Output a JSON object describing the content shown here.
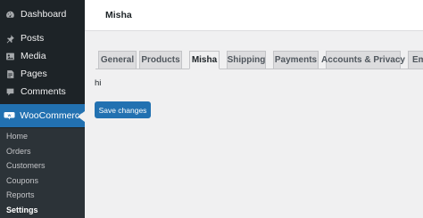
{
  "sidebar": {
    "items": [
      {
        "label": "Dashboard",
        "icon": "dashboard-icon"
      },
      {
        "label": "Posts",
        "icon": "pin-icon"
      },
      {
        "label": "Media",
        "icon": "media-icon"
      },
      {
        "label": "Pages",
        "icon": "page-icon"
      },
      {
        "label": "Comments",
        "icon": "comment-icon"
      },
      {
        "label": "WooCommerce",
        "icon": "woocommerce-icon"
      }
    ],
    "submenu": [
      {
        "label": "Home"
      },
      {
        "label": "Orders"
      },
      {
        "label": "Customers"
      },
      {
        "label": "Coupons"
      },
      {
        "label": "Reports"
      },
      {
        "label": "Settings"
      }
    ],
    "colors": {
      "background": "#1d2327",
      "active": "#2271b1",
      "submenu_bg": "#2c3338"
    }
  },
  "header": {
    "title": "Misha"
  },
  "tabs": [
    {
      "label": "General"
    },
    {
      "label": "Products"
    },
    {
      "label": "Misha"
    },
    {
      "label": "Shipping"
    },
    {
      "label": "Payments"
    },
    {
      "label": "Accounts & Privacy"
    },
    {
      "label": "Em"
    }
  ],
  "active_tab": "Misha",
  "main": {
    "content_text": "hi",
    "save_label": "Save changes"
  }
}
